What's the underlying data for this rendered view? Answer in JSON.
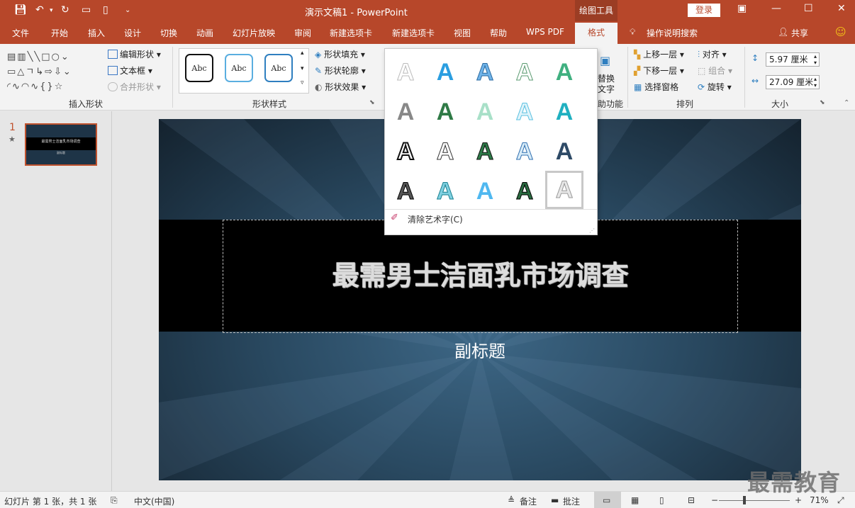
{
  "titlebar": {
    "doc_title": "演示文稿1  -  PowerPoint",
    "tools_title": "绘图工具",
    "login": "登录",
    "qa_icons": [
      "save-icon",
      "undo-icon",
      "redo-icon",
      "slideshow-icon",
      "new-icon",
      "customize-icon"
    ]
  },
  "tabs": {
    "file": "文件",
    "home": "开始",
    "insert": "插入",
    "design": "设计",
    "transitions": "切换",
    "animations": "动画",
    "slideshow": "幻灯片放映",
    "review": "审阅",
    "newtab1": "新建选项卡",
    "newtab2": "新建选项卡",
    "view": "视图",
    "help": "帮助",
    "wpspdf": "WPS PDF",
    "format": "格式",
    "tellme": "操作说明搜索",
    "share": "共享"
  },
  "ribbon": {
    "insert_shapes": {
      "label": "插入形状",
      "edit_shape": "编辑形状",
      "textbox": "文本框",
      "merge": "合并形状"
    },
    "shape_styles": {
      "label": "形状样式",
      "sample": "Abc",
      "fill": "形状填充",
      "outline": "形状轮廓",
      "effects": "形状效果"
    },
    "accessibility": {
      "alt_text_1": "替换",
      "alt_text_2": "文字",
      "label": "助功能"
    },
    "arrange": {
      "label": "排列",
      "bring_forward": "上移一层",
      "send_backward": "下移一层",
      "selection_pane": "选择窗格",
      "align": "对齐",
      "group": "组合",
      "rotate": "旋转"
    },
    "size": {
      "label": "大小",
      "height": "5.97 厘米",
      "width": "27.09 厘米"
    }
  },
  "thumbnail": {
    "num": "1",
    "star": "★",
    "title": "最需男士洁面乳市场调查",
    "sub": "副标题"
  },
  "slide": {
    "title": "最需男士洁面乳市场调查",
    "subtitle": "副标题"
  },
  "gallery": {
    "letter": "A",
    "clear": "清除艺术字(C)",
    "resize": "⋰"
  },
  "status": {
    "slide_info": "幻灯片 第 1 张，共 1 张",
    "language": "中文(中国)",
    "notes": "备注",
    "comments": "批注",
    "zoom": "71%"
  },
  "watermark": "最需教育"
}
